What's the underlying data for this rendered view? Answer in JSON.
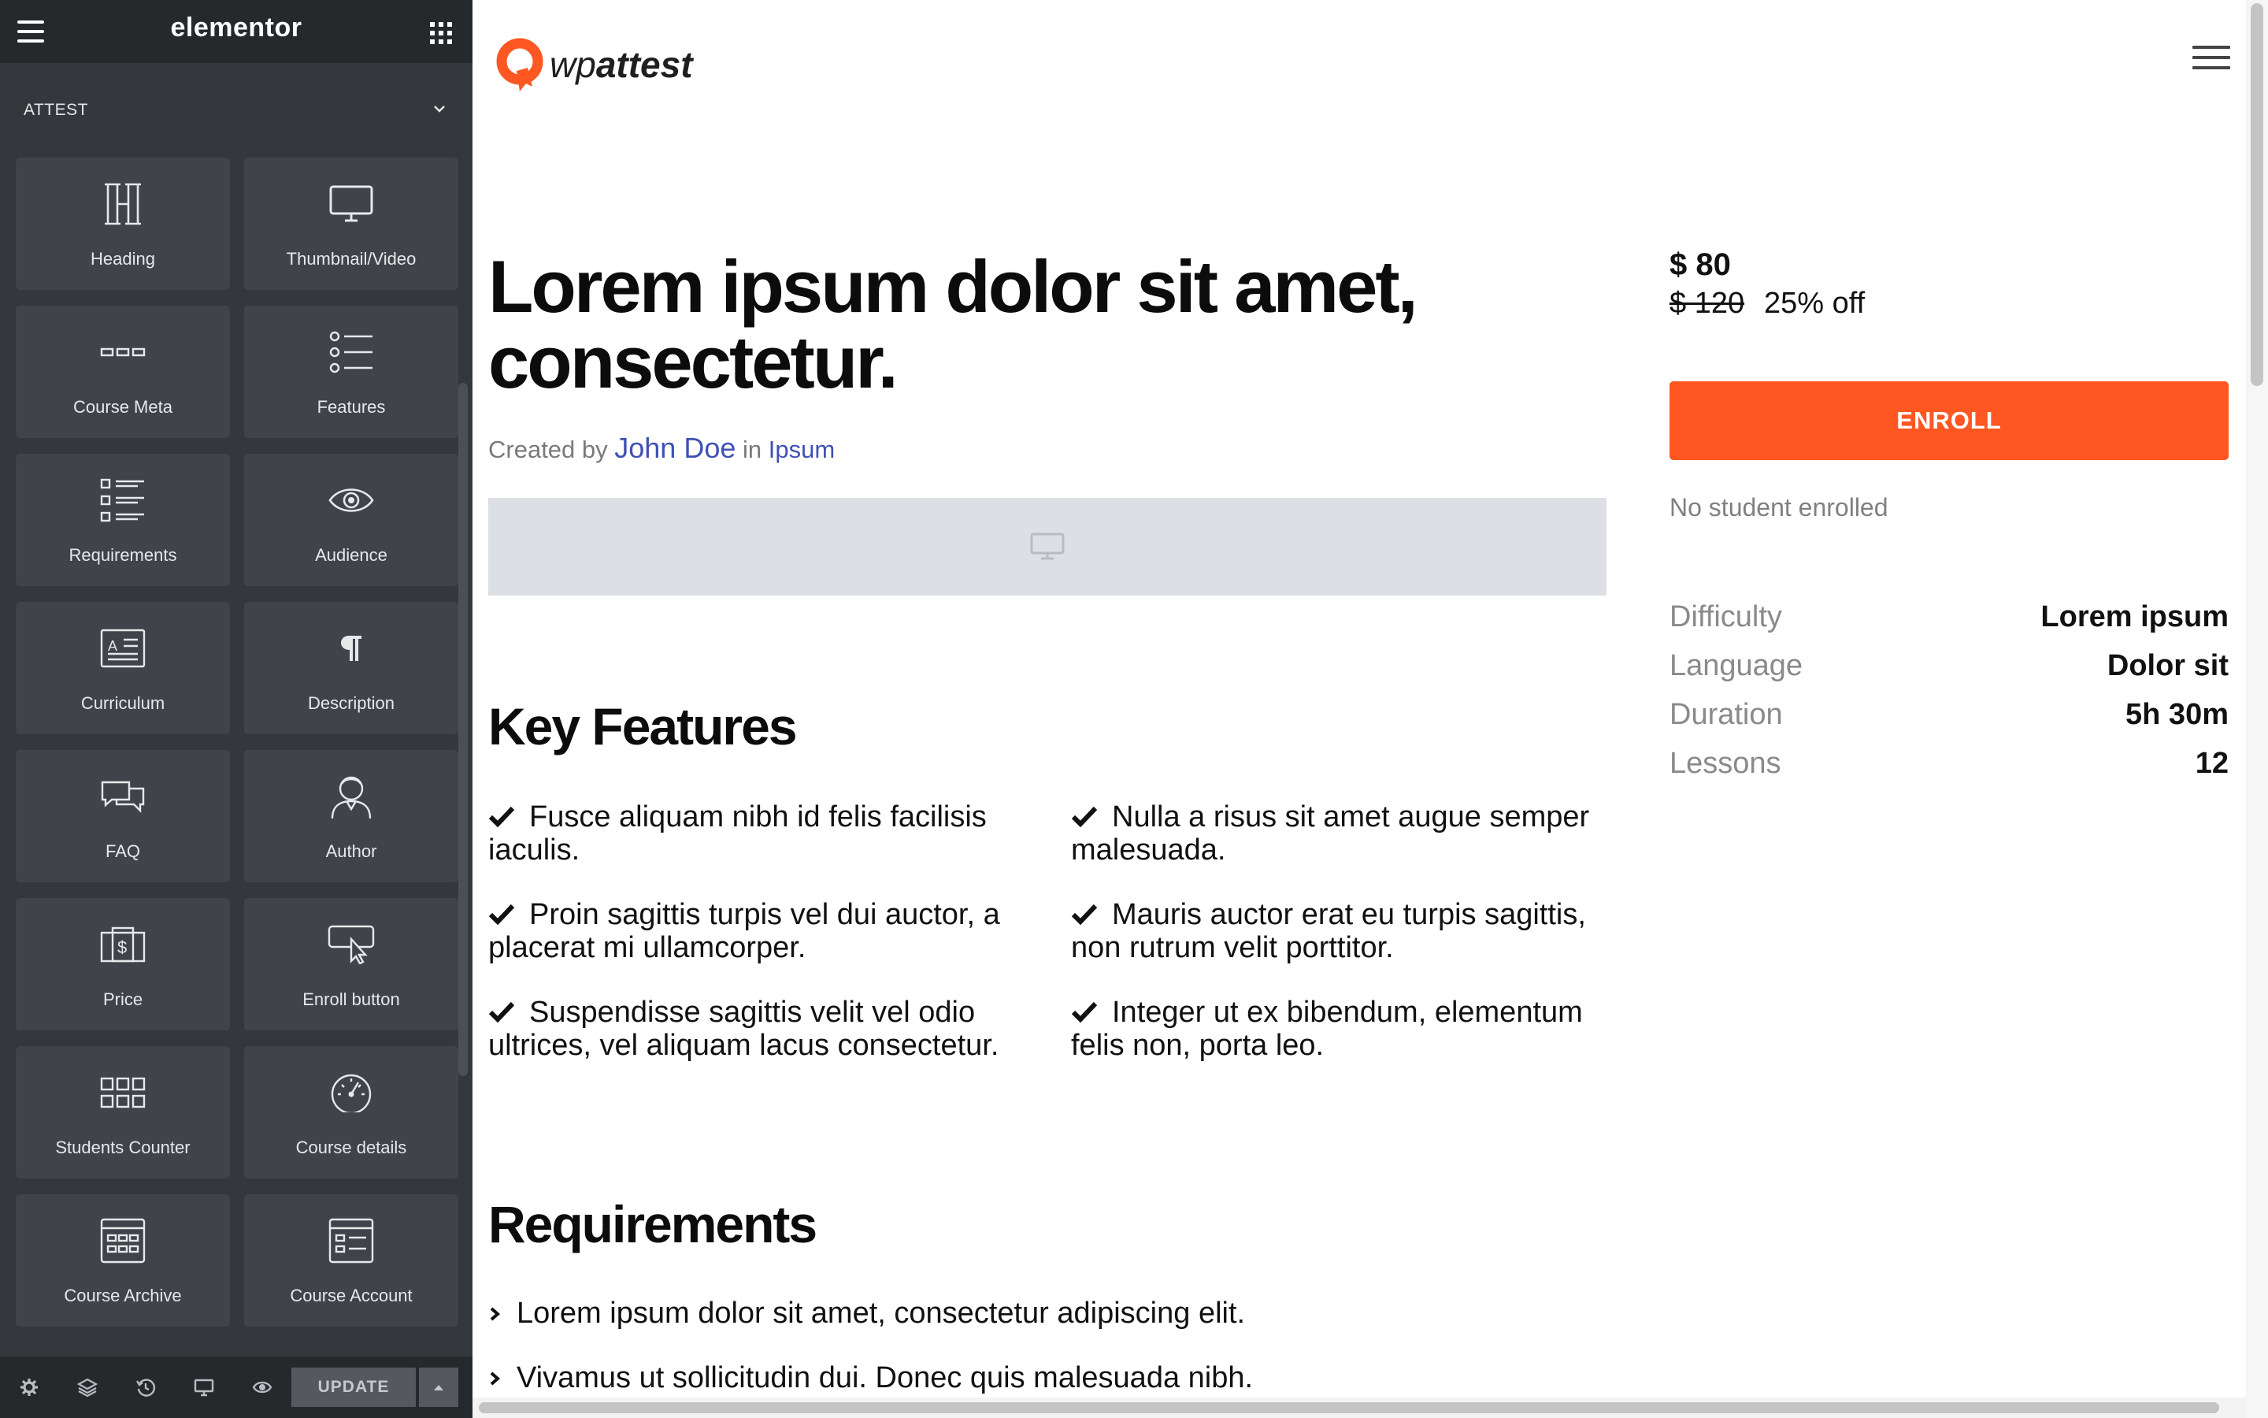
{
  "panel": {
    "brand": "elementor",
    "category": "ATTEST",
    "widgets": [
      {
        "label": "Heading",
        "icon": "heading-icon"
      },
      {
        "label": "Thumbnail/Video",
        "icon": "monitor-icon"
      },
      {
        "label": "Course Meta",
        "icon": "course-meta-icon"
      },
      {
        "label": "Features",
        "icon": "features-list-icon"
      },
      {
        "label": "Requirements",
        "icon": "requirements-icon"
      },
      {
        "label": "Audience",
        "icon": "eye-icon"
      },
      {
        "label": "Curriculum",
        "icon": "curriculum-icon"
      },
      {
        "label": "Description",
        "icon": "paragraph-icon"
      },
      {
        "label": "FAQ",
        "icon": "faq-chat-icon"
      },
      {
        "label": "Author",
        "icon": "author-icon"
      },
      {
        "label": "Price",
        "icon": "price-icon"
      },
      {
        "label": "Enroll button",
        "icon": "enroll-cursor-icon"
      },
      {
        "label": "Students Counter",
        "icon": "students-grid-icon"
      },
      {
        "label": "Course details",
        "icon": "gauge-icon"
      },
      {
        "label": "Course Archive",
        "icon": "archive-icon"
      },
      {
        "label": "Course Account",
        "icon": "account-icon"
      }
    ],
    "footer": {
      "update_label": "UPDATE",
      "icons": [
        "settings-gear-icon",
        "layers-icon",
        "history-icon",
        "responsive-monitor-icon",
        "preview-eye-icon"
      ]
    }
  },
  "site": {
    "logo_prefix": "wp",
    "logo_suffix": "attest"
  },
  "course": {
    "title": "Lorem ipsum dolor sit amet, consectetur.",
    "created_by": "Created by",
    "author": "John Doe",
    "in_label": "in",
    "category": "Ipsum",
    "key_features_title": "Key Features",
    "features": [
      "Fusce aliquam nibh id felis facilisis iaculis.",
      "Nulla a risus sit amet augue semper malesuada.",
      "Proin sagittis turpis vel dui auctor, a placerat mi ullamcorper.",
      "Mauris auctor erat eu turpis sagittis, non rutrum velit porttitor.",
      "Suspendisse sagittis velit vel odio ultrices, vel aliquam lacus consectetur.",
      "Integer ut ex bibendum, elementum felis non, porta leo."
    ],
    "requirements_title": "Requirements",
    "requirements": [
      "Lorem ipsum dolor sit amet, consectetur adipiscing elit.",
      "Vivamus ut sollicitudin dui. Donec quis malesuada nibh."
    ]
  },
  "sidebar": {
    "price": "$ 80",
    "old_price": "$ 120",
    "discount": "25% off",
    "enroll_label": "ENROLL",
    "enroll_status": "No student enrolled",
    "details": [
      {
        "label": "Difficulty",
        "value": "Lorem ipsum"
      },
      {
        "label": "Language",
        "value": "Dolor sit"
      },
      {
        "label": "Duration",
        "value": "5h 30m"
      },
      {
        "label": "Lessons",
        "value": "12"
      }
    ]
  },
  "colors": {
    "accent": "#ff5722",
    "link": "#3f51b5",
    "panel_bg": "#34383c",
    "panel_header": "#26292c"
  }
}
